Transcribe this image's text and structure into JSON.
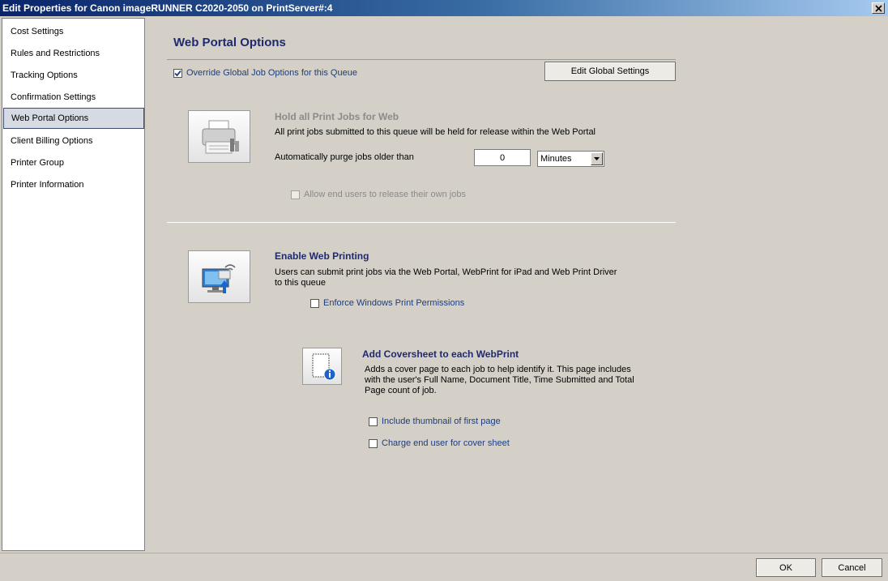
{
  "window": {
    "title": "Edit Properties for Canon imageRUNNER C2020-2050 on PrintServer#:4",
    "close_label": "X"
  },
  "sidebar": {
    "items": [
      {
        "label": "Cost Settings"
      },
      {
        "label": "Rules and Restrictions"
      },
      {
        "label": "Tracking Options"
      },
      {
        "label": "Confirmation Settings"
      },
      {
        "label": "Web Portal Options"
      },
      {
        "label": "Client Billing Options"
      },
      {
        "label": "Printer Group"
      },
      {
        "label": "Printer Information"
      }
    ],
    "selected_index": 4
  },
  "main": {
    "title": "Web Portal Options",
    "override": {
      "label": "Override Global Job Options for this Queue",
      "checked": true
    },
    "edit_global_label": "Edit Global Settings",
    "hold": {
      "title": "Hold all Print Jobs for Web",
      "description": "All print jobs submitted to this queue will be held for release within the Web Portal",
      "purge_label": "Automatically purge jobs older than",
      "purge_value": "0",
      "purge_unit": "Minutes",
      "allow_release_label": "Allow end users to release their own jobs",
      "allow_release_checked": false
    },
    "web_printing": {
      "title": "Enable Web Printing",
      "description_line1": "Users can submit print jobs via the Web Portal, WebPrint for iPad and Web Print Driver",
      "description_line2": "to this queue",
      "enforce_label": "Enforce Windows Print Permissions",
      "enforce_checked": false
    },
    "coversheet": {
      "title": "Add Coversheet to each WebPrint",
      "description_line1": "Adds a cover page to each job to help identify it. This page includes",
      "description_line2": "with the user's Full Name, Document Title, Time Submitted and Total",
      "description_line3": "Page count of job.",
      "thumbnail_label": "Include thumbnail of first page",
      "thumbnail_checked": false,
      "charge_label": "Charge end user for cover sheet",
      "charge_checked": false
    }
  },
  "footer": {
    "ok_label": "OK",
    "cancel_label": "Cancel"
  },
  "colors": {
    "heading": "#1f2a6e",
    "link": "#1c3d7e",
    "selection": "#d6dae2"
  }
}
